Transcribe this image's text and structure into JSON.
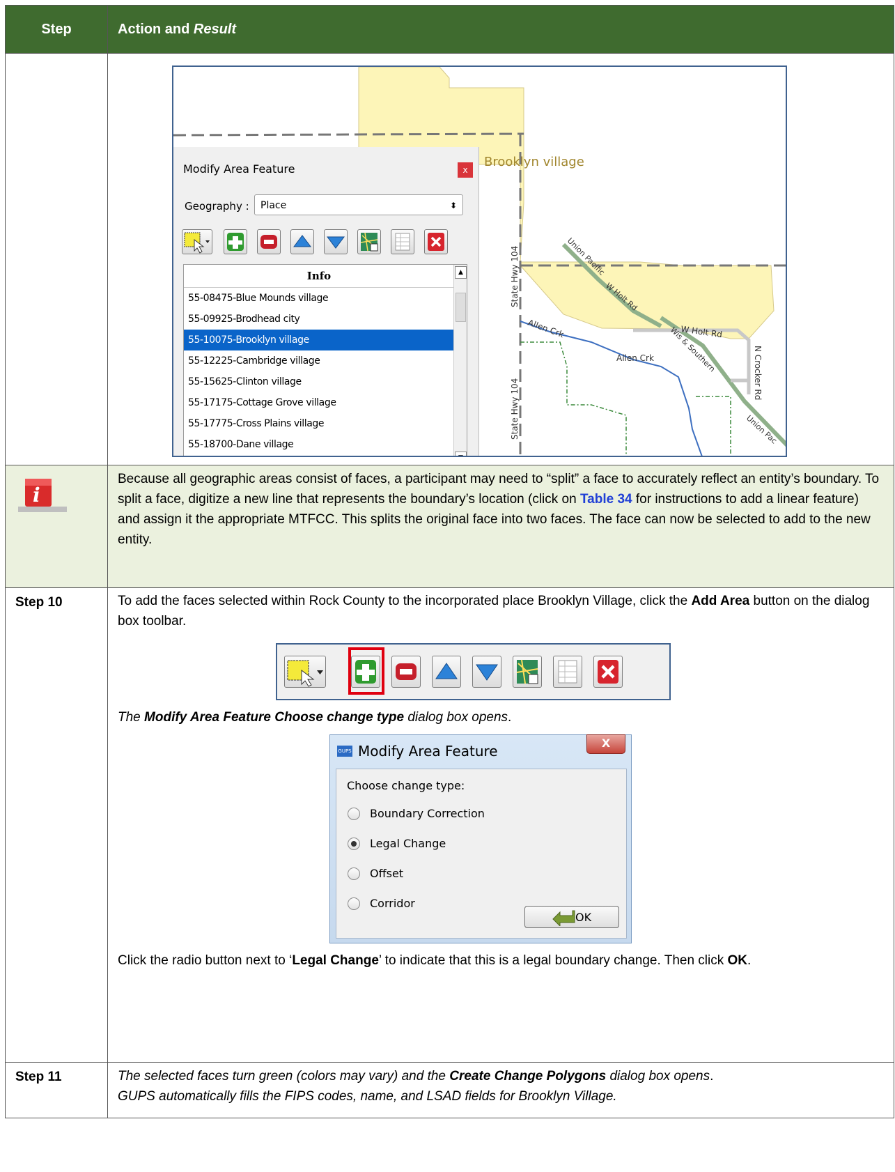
{
  "header": {
    "step": "Step",
    "action": "Action and ",
    "result": "Result"
  },
  "screenshot1": {
    "panel_title": "Modify Area Feature",
    "close_label": "x",
    "geography_label": "Geography :",
    "geography_value": "Place",
    "list_header": "Info",
    "list_items": [
      "55-08475-Blue Mounds village",
      "55-09925-Brodhead city",
      "55-10075-Brooklyn village",
      "55-12225-Cambridge village",
      "55-15625-Clinton village",
      "55-17175-Cottage Grove village",
      "55-17775-Cross Plains village",
      "55-18700-Dane village"
    ],
    "selected_index": 2,
    "map_labels": {
      "place": "Brooklyn village",
      "hwy1": "State Hwy 104",
      "hwy2": "State Hwy 104",
      "rail1": "Union Pacific",
      "holt1": "W Holt Rd",
      "holt2": "W Holt Rd",
      "allen1": "Allen Crk",
      "allen2": "Allen Crk",
      "rail2": "Wis & Southern",
      "crocker": "N Crocker Rd",
      "rail3": "Union Pac"
    }
  },
  "note": {
    "before_link": "Because all geographic areas consist of faces, a participant may need to “split” a face to accurately reflect an entity’s boundary. To split a face, digitize a new line that represents the boundary’s location (click on ",
    "link": "Table 34",
    "after_link": " for instructions to add a linear feature) and assign it the appropriate MTFCC. This splits the original face into two faces. The face can now be selected to add to the new entity."
  },
  "step10": {
    "label": "Step 10",
    "text1": "To add the faces selected within Rock County to the incorporated place Brooklyn Village, click the ",
    "bold1": "Add Area",
    "text2": " button on the dialog box toolbar.",
    "result_pre": "The ",
    "result_bold": "Modify Area Feature Choose change type",
    "result_post": " dialog box opens",
    "result_end": ".",
    "dialog": {
      "title": "Modify Area Feature",
      "icon_text": "GUPS",
      "close": "X",
      "prompt": "Choose change type:",
      "options": [
        "Boundary Correction",
        "Legal Change",
        "Offset",
        "Corridor"
      ],
      "selected": "Legal Change",
      "ok": "OK"
    },
    "instr_1": "Click the radio button next to ‘",
    "instr_bold": "Legal Change",
    "instr_2": "’ to indicate that this is a legal boundary change. Then click ",
    "instr_ok": "OK",
    "instr_end": "."
  },
  "step11": {
    "label": "Step 11",
    "t1": "The selected faces turn green (colors may vary) and the ",
    "b1": "Create Change Polygons",
    "t2": " dialog box opens",
    "t3": ".",
    "t4": "GUPS automatically fills the FIPS codes, name, and LSAD fields for Brooklyn Village."
  },
  "colors": {
    "header_bg": "#3f6b2f",
    "note_bg": "#ebf1de",
    "place_fill": "#fdf5b8",
    "selected_row": "#0a64c9",
    "link": "#1f3fd6"
  }
}
